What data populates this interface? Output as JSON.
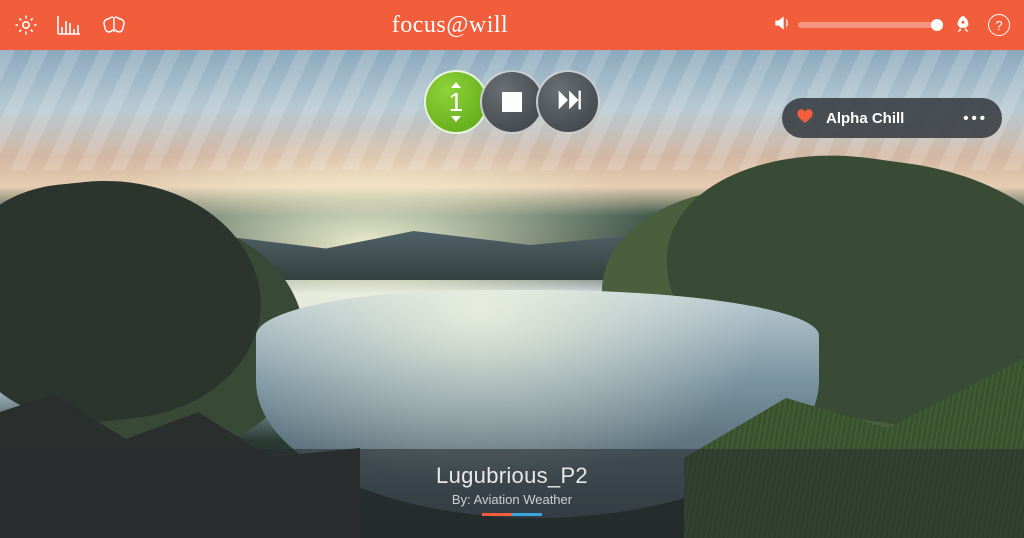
{
  "header": {
    "brand": "focus@will",
    "help_label": "?"
  },
  "volume": {
    "level_percent": 100
  },
  "player": {
    "energy_level": "1"
  },
  "channel": {
    "name": "Alpha Chill",
    "favorited": true
  },
  "now_playing": {
    "track_title": "Lugubrious_P2",
    "artist_prefix": "By: ",
    "artist": "Aviation Weather"
  },
  "colors": {
    "accent": "#f25d3b",
    "energy_green": "#6ab51e"
  }
}
